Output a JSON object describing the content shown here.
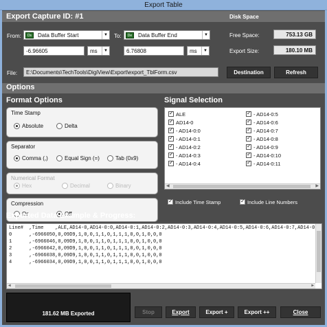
{
  "window": {
    "title": "Export Table"
  },
  "header": {
    "title": "Export Capture ID: #1",
    "disk_title": "Disk Space"
  },
  "from": {
    "label": "From:",
    "tag": "Ds",
    "source": "Data Buffer Start",
    "value": "-6.96605",
    "unit": "ms"
  },
  "to": {
    "label": "To:",
    "tag": "De",
    "source": "Data Buffer End",
    "value": "6.76808",
    "unit": "ms"
  },
  "disk": {
    "free_label": "Free Space:",
    "free_value": "753.13 GB",
    "export_label": "Export Size:",
    "export_value": "180.10 MB"
  },
  "file": {
    "label": "File:",
    "path": "E:\\Documents\\TechTools\\DigiView\\Export\\export_TblForm.csv",
    "destination_btn": "Destination",
    "refresh_btn": "Refresh"
  },
  "options_band": "Options",
  "format": {
    "title": "Format Options",
    "timestamp": {
      "title": "Time Stamp",
      "options": [
        "Absolute",
        "Delta"
      ],
      "selected": "Absolute"
    },
    "separator": {
      "title": "Separator",
      "options": [
        "Comma (,)",
        "Equal Sign (=)",
        "Tab (0x9)"
      ],
      "selected": "Comma (,)"
    },
    "numeric": {
      "title": "Numerical Format",
      "options": [
        "Hex",
        "Decimal",
        "Binary"
      ],
      "selected": "Hex"
    },
    "compression": {
      "title": "Compression",
      "options": [
        "On",
        "Off"
      ],
      "selected": "Off"
    }
  },
  "signals": {
    "title": "Signal Selection",
    "left": [
      "ALE",
      "AD14-0",
      "- AD14-0:0",
      "- AD14-0:1",
      "- AD14-0:2",
      "- AD14-0:3",
      "- AD14-0:4"
    ],
    "right": [
      "- AD14-0:5",
      "- AD14-0:6",
      "- AD14-0:7",
      "- AD14-0:8",
      "- AD14-0:9",
      "- AD14-0:10",
      "- AD14-0:11"
    ],
    "include_timestamp": "Include Time Stamp",
    "include_line_numbers": "Include Line Numbers"
  },
  "preview": {
    "title": "Exported Data Example & Progress:",
    "lines": [
      "Line#  ,Time    ,ALE,AD14-0,AD14-0:0,AD14-0:1,AD14-0:2,AD14-0:3,AD14-0:4,AD14-0:5,AD14-0:6,AD14-0:7,AD14-0:8,AD14-0:9,A",
      "0      ,-6966050,0,09D9,1,0,0,1,1,0,1,1,1,0,0,1,0,0,0",
      "1      ,-6966046,0,09D9,1,0,0,1,1,0,1,1,1,0,0,1,0,0,0",
      "2      ,-6966042,0,09D9,1,0,0,1,1,0,1,1,1,0,0,1,0,0,0",
      "3      ,-6966038,0,09D9,1,0,0,1,1,0,1,1,1,0,0,1,0,0,0",
      "4      ,-6966034,0,09D9,1,0,0,1,1,0,1,1,1,0,0,1,0,0,0"
    ]
  },
  "progress": {
    "text": "181.62 MB Exported"
  },
  "buttons": {
    "stop": "Stop",
    "export": "Export",
    "export_plus": "Export +",
    "export_plusplus": "Export ++",
    "close": "Close"
  }
}
